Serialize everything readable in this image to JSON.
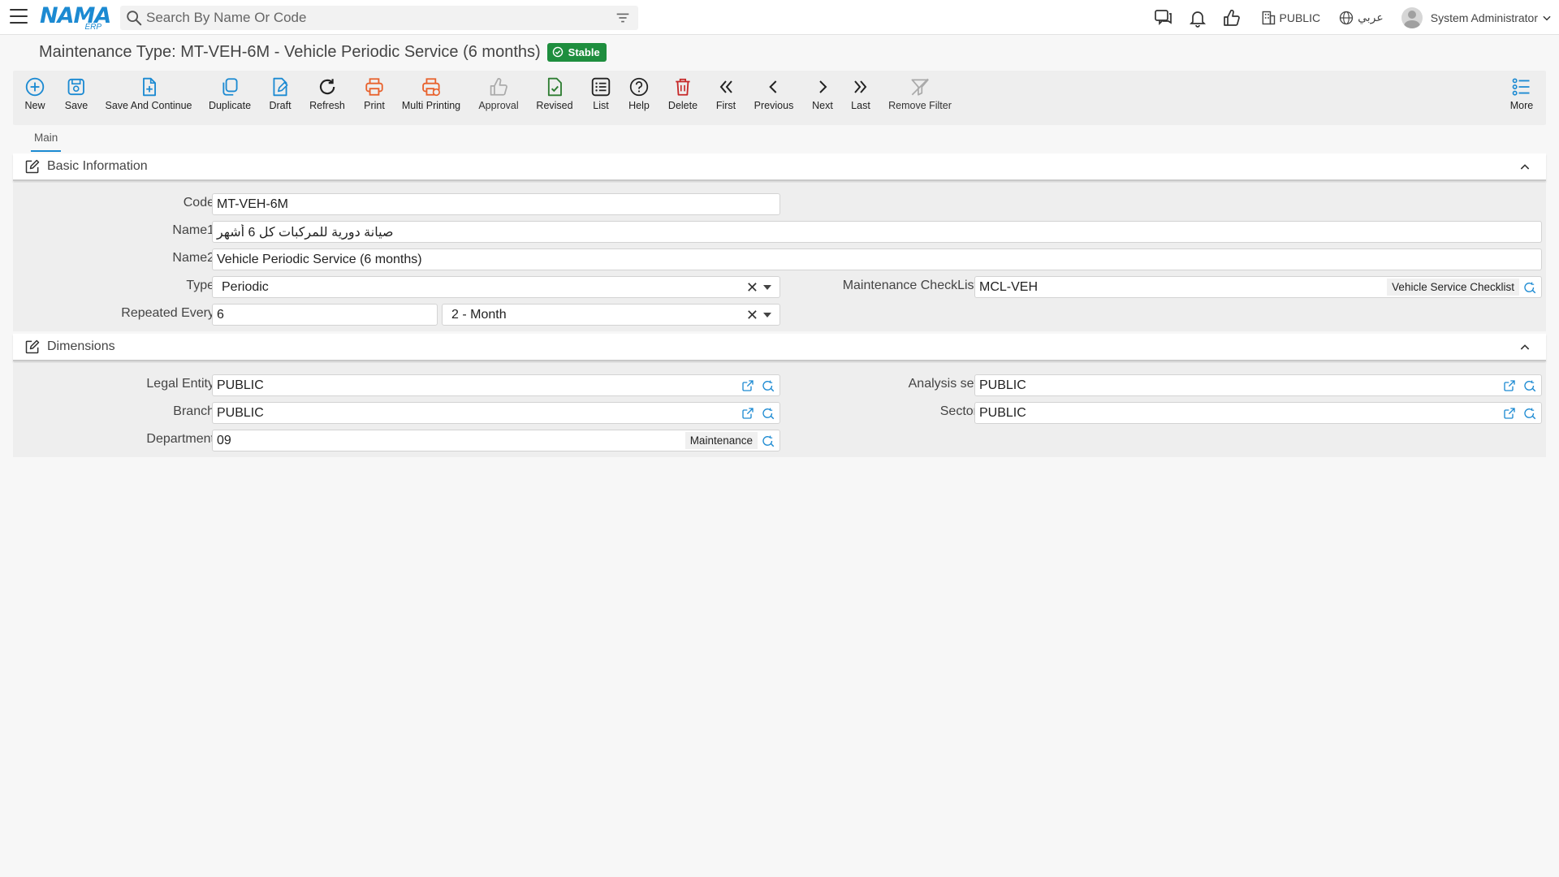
{
  "app": {
    "logo_text": "NAMA",
    "logo_sub": "ERP"
  },
  "search": {
    "placeholder": "Search By Name Or Code"
  },
  "topbar": {
    "legal_entity": "PUBLIC",
    "language": "عربي",
    "user": "System Administrator"
  },
  "page": {
    "title": "Maintenance Type: MT-VEH-6M - Vehicle Periodic Service (6 months)",
    "status": "Stable"
  },
  "toolbar": {
    "new": "New",
    "save": "Save",
    "save_continue": "Save And Continue",
    "duplicate": "Duplicate",
    "draft": "Draft",
    "refresh": "Refresh",
    "print": "Print",
    "multi_printing": "Multi Printing",
    "approval": "Approval",
    "revised": "Revised",
    "list": "List",
    "help": "Help",
    "delete": "Delete",
    "first": "First",
    "previous": "Previous",
    "next": "Next",
    "last": "Last",
    "remove_filter": "Remove Filter",
    "more": "More"
  },
  "tabs": {
    "main": "Main"
  },
  "basic": {
    "header": "Basic Information",
    "code_label": "Code",
    "code": "MT-VEH-6M",
    "name1_label": "Name1",
    "name1": "صيانة دورية للمركبات كل 6 أشهر",
    "name2_label": "Name2",
    "name2": "Vehicle Periodic Service (6 months)",
    "type_label": "Type",
    "type": "Periodic",
    "checklist_label": "Maintenance CheckList",
    "checklist_code": "MCL-VEH",
    "checklist_name": "Vehicle Service Checklist",
    "repeated_label": "Repeated Every",
    "repeated_value": "6",
    "repeated_unit": "2 - Month"
  },
  "dimensions": {
    "header": "Dimensions",
    "legal_entity_label": "Legal Entity",
    "legal_entity": "PUBLIC",
    "analysis_set_label": "Analysis set",
    "analysis_set": "PUBLIC",
    "branch_label": "Branch",
    "branch": "PUBLIC",
    "sector_label": "Sector",
    "sector": "PUBLIC",
    "department_label": "Department",
    "department_code": "09",
    "department_name": "Maintenance"
  },
  "colors": {
    "accent": "#1c8ad2",
    "print_orange": "#e8612c",
    "delete_red": "#c62828",
    "revised_green": "#2e7d32",
    "stable_green": "#1e8e3e"
  }
}
